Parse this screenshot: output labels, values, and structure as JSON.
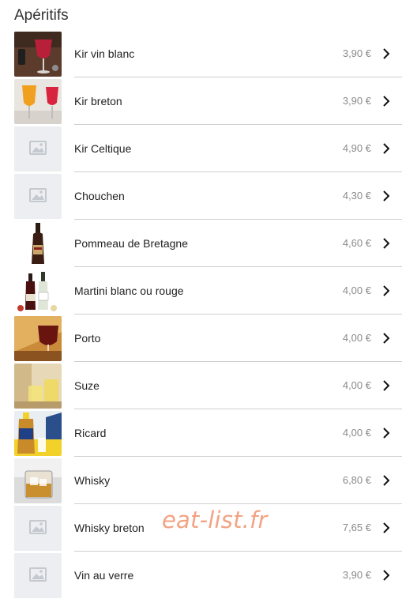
{
  "section_title": "Apéritifs",
  "watermark": "eat-list.fr",
  "items": [
    {
      "name": "Kir vin blanc",
      "price": "3,90 €",
      "image": "kir-vin-blanc-photo"
    },
    {
      "name": "Kir breton",
      "price": "3,90 €",
      "image": "kir-breton-photo"
    },
    {
      "name": "Kir Celtique",
      "price": "4,90 €",
      "image": "placeholder-image-icon"
    },
    {
      "name": "Chouchen",
      "price": "4,30 €",
      "image": "placeholder-image-icon"
    },
    {
      "name": "Pommeau de Bretagne",
      "price": "4,60 €",
      "image": "pommeau-bottle-photo"
    },
    {
      "name": "Martini blanc ou rouge",
      "price": "4,00 €",
      "image": "martini-bottles-photo"
    },
    {
      "name": "Porto",
      "price": "4,00 €",
      "image": "porto-glass-photo"
    },
    {
      "name": "Suze",
      "price": "4,00 €",
      "image": "suze-glasses-photo"
    },
    {
      "name": "Ricard",
      "price": "4,00 €",
      "image": "ricard-bottle-photo"
    },
    {
      "name": "Whisky",
      "price": "6,80 €",
      "image": "whisky-glass-photo"
    },
    {
      "name": "Whisky breton",
      "price": "7,65 €",
      "image": "placeholder-image-icon"
    },
    {
      "name": "Vin au verre",
      "price": "3,90 €",
      "image": "placeholder-image-icon"
    }
  ]
}
